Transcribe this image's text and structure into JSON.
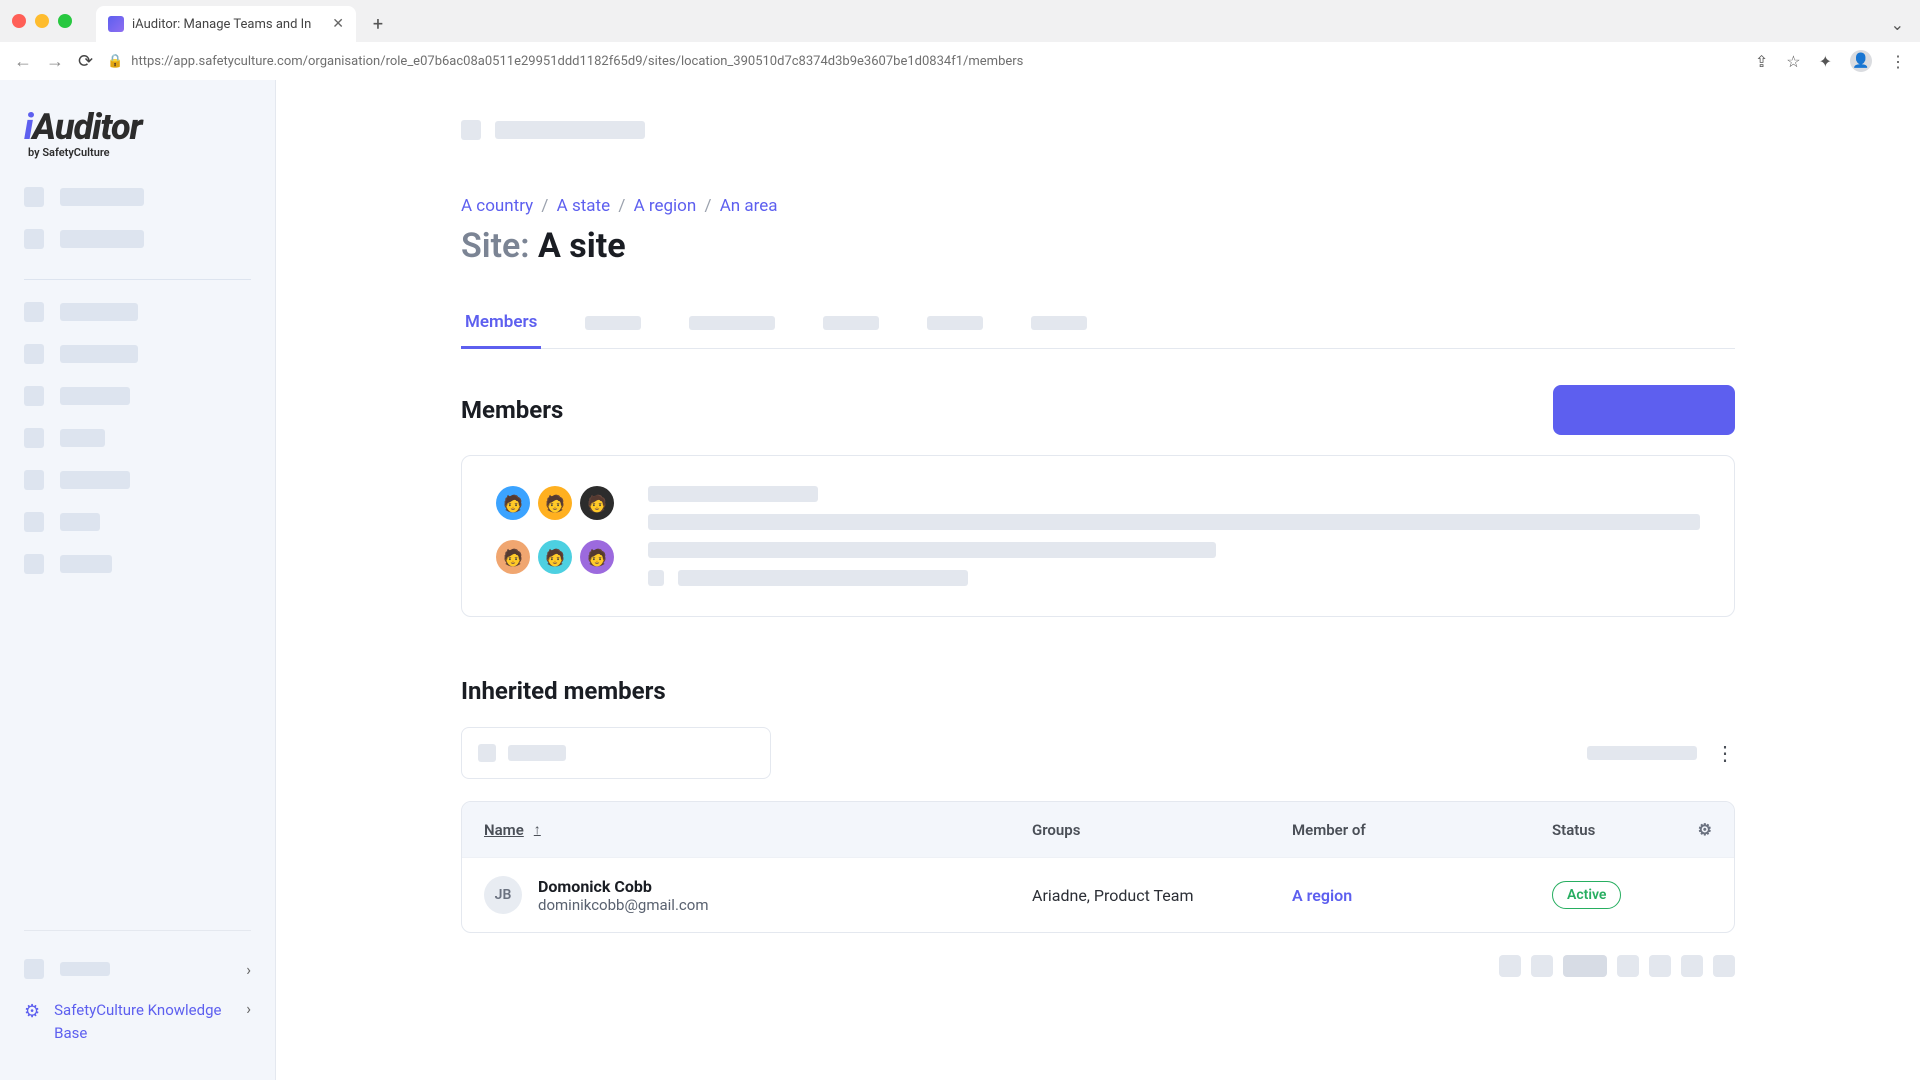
{
  "browser": {
    "tab_title": "iAuditor: Manage Teams and In",
    "url": "https://app.safetyculture.com/organisation/role_e07b6ac08a0511e29951ddd1182f65d9/sites/location_390510d7c8374d3b9e3607be1d0834f1/members"
  },
  "logo": {
    "brand": "iAuditor",
    "byline": "by SafetyCulture"
  },
  "knowledge_base": "SafetyCulture Knowledge Base",
  "breadcrumbs": [
    {
      "label": "A country"
    },
    {
      "label": "A state"
    },
    {
      "label": "A region"
    },
    {
      "label": "An area"
    }
  ],
  "page": {
    "prefix": "Site: ",
    "title": "A site"
  },
  "tabs": {
    "active": "Members"
  },
  "sections": {
    "members": "Members",
    "inherited": "Inherited members"
  },
  "table": {
    "headers": {
      "name": "Name",
      "groups": "Groups",
      "member_of": "Member of",
      "status": "Status"
    },
    "rows": [
      {
        "initials": "JB",
        "name": "Domonick Cobb",
        "email": "dominikcobb@gmail.com",
        "groups": "Ariadne, Product Team",
        "member_of": "A region",
        "status": "Active"
      }
    ]
  }
}
